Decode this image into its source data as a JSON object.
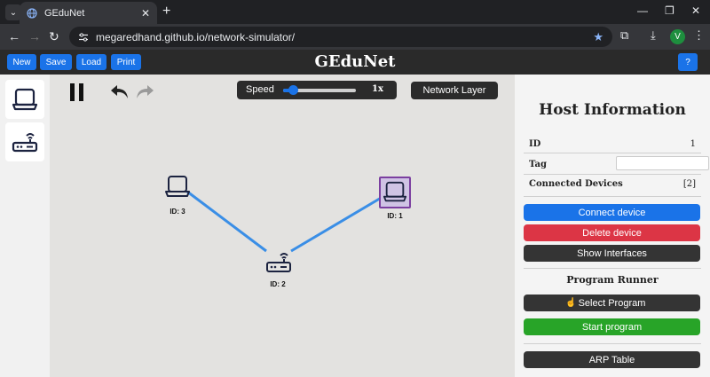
{
  "browser": {
    "tab_title": "GEduNet",
    "url": "megaredhand.github.io/network-simulator/",
    "profile_initial": "V"
  },
  "header": {
    "title": "GEduNet",
    "buttons": {
      "new": "New",
      "save": "Save",
      "load": "Load",
      "print": "Print",
      "help": "?"
    },
    "accent": "#1a73e8"
  },
  "palette": {
    "items": [
      {
        "name": "host",
        "icon": "laptop-icon"
      },
      {
        "name": "router",
        "icon": "router-icon"
      }
    ]
  },
  "canvas": {
    "speed_label": "Speed",
    "speed_value": "1x",
    "speed_level": 0.1,
    "layer_button": "Network Layer",
    "nodes": [
      {
        "id_label": "ID: 3",
        "type": "host"
      },
      {
        "id_label": "ID: 2",
        "type": "router"
      },
      {
        "id_label": "ID: 1",
        "type": "host",
        "selected": true
      }
    ],
    "link_color": "#3a8ee6"
  },
  "info_panel": {
    "title": "Host Information",
    "id_label": "ID",
    "id_value": "1",
    "tag_label": "Tag",
    "tag_value": "",
    "connected_label": "Connected Devices",
    "connected_value": "[2]",
    "buttons": {
      "connect": "Connect device",
      "delete": "Delete device",
      "interfaces": "Show Interfaces",
      "select_program": "Select Program",
      "start_program": "Start program",
      "arp_table": "ARP Table"
    },
    "runner_title": "Program Runner",
    "colors": {
      "connect": "#1a73e8",
      "delete": "#dc3545",
      "dark": "#343434",
      "start": "#28a428"
    }
  }
}
